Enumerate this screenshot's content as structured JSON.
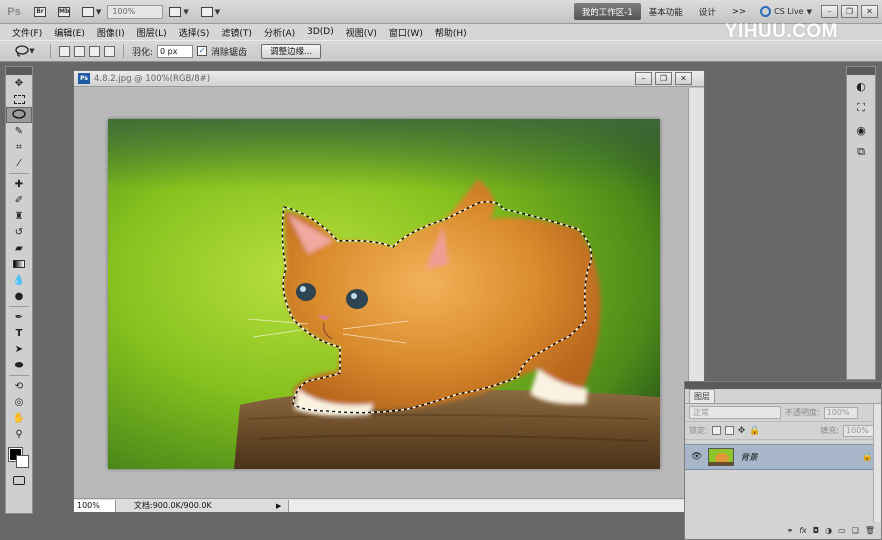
{
  "appbar": {
    "logo": "Ps",
    "zoom": "100%",
    "workspace_tabs": [
      {
        "label": "我的工作区-1",
        "active": true
      },
      {
        "label": "基本功能",
        "active": false
      },
      {
        "label": "设计",
        "active": false
      }
    ],
    "more": ">>",
    "cs_live": "CS Live"
  },
  "watermark": "YIHUU.COM",
  "menu": [
    "文件(F)",
    "编辑(E)",
    "图像(I)",
    "图层(L)",
    "选择(S)",
    "滤镜(T)",
    "分析(A)",
    "3D(D)",
    "视图(V)",
    "窗口(W)",
    "帮助(H)"
  ],
  "options": {
    "feather_label": "羽化:",
    "feather_value": "0 px",
    "antialias_label": "消除锯齿",
    "antialias_checked": "✓",
    "refine_edge_button": "调整边缘..."
  },
  "document": {
    "title": "4.8.2.jpg @ 100%(RGB/8#)",
    "zoom": "100%",
    "info": "文档:900.0K/900.0K",
    "status_arrow": "▶"
  },
  "layers_panel": {
    "tab": "图层",
    "blend_mode": "正常",
    "opacity_label": "不透明度:",
    "opacity_value": "100%",
    "lock_label": "锁定:",
    "fill_label": "填充:",
    "fill_value": "100%",
    "layer_name": "背景",
    "footer_icons": [
      "link-icon",
      "fx-icon",
      "mask-icon",
      "adjustment-icon",
      "group-icon",
      "new-layer-icon",
      "trash-icon"
    ]
  },
  "colors": {
    "accent": "#1f5aa3",
    "selected_layer": "#a7b6c9",
    "panel_bg": "#d3d3d3"
  }
}
